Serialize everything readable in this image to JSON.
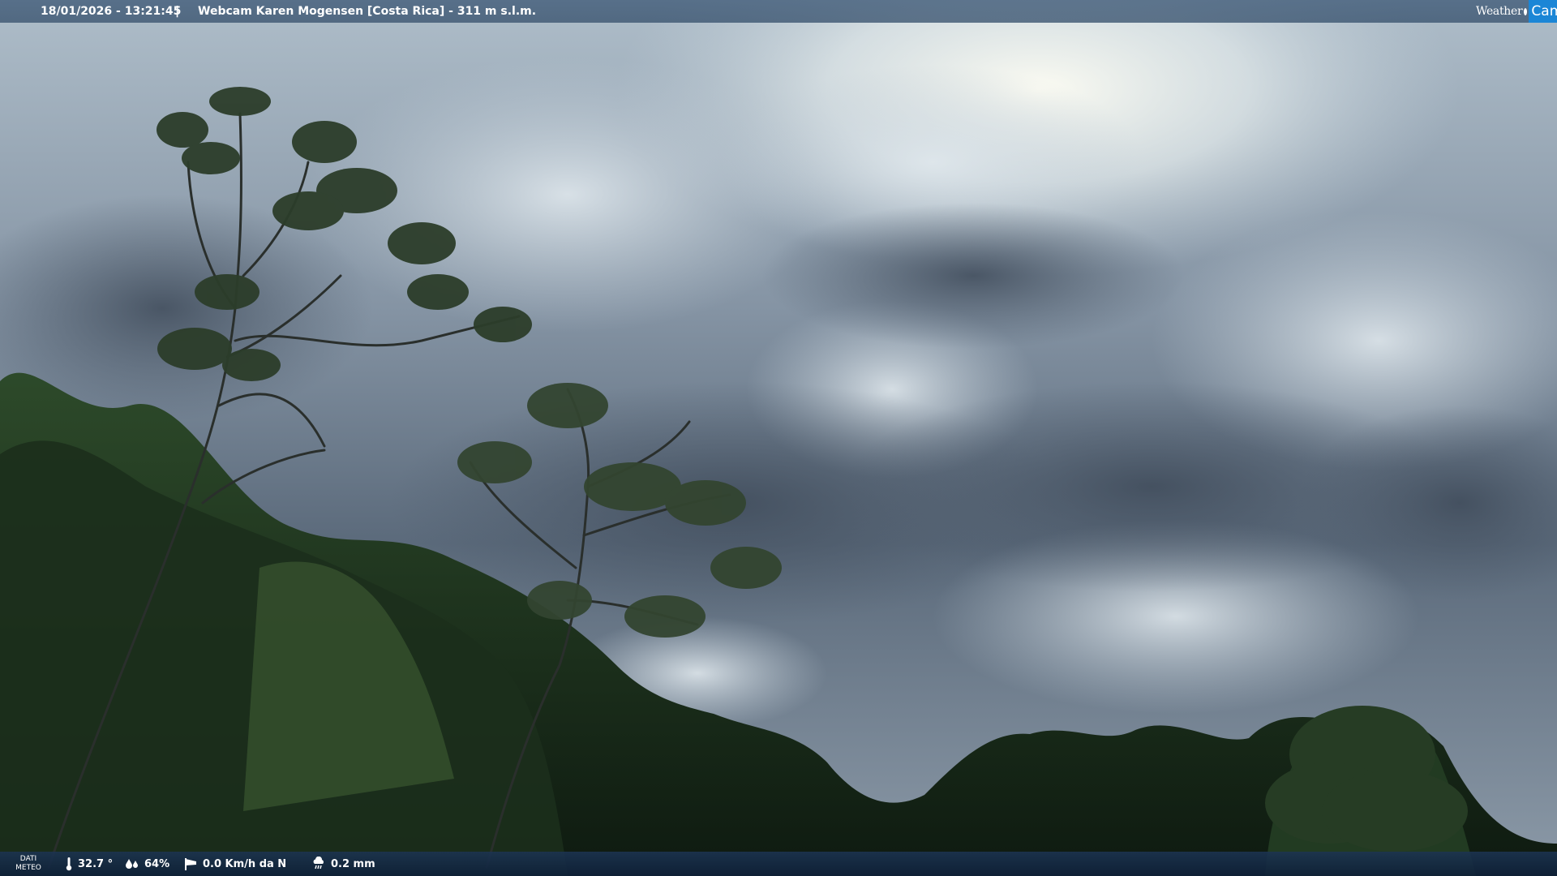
{
  "header": {
    "datetime": "18/01/2026 - 13:21:45",
    "separator": "|",
    "title": "Webcam Karen Mogensen [Costa Rica] - 311 m s.l.m."
  },
  "logo": {
    "word": "Weather",
    "cam": "Cam"
  },
  "meteo": {
    "label_line1": "DATI",
    "label_line2": "METEO",
    "temperature": "32.7 °",
    "humidity": "64%",
    "wind": "0.0 Km/h da N",
    "rain": "0.2 mm"
  },
  "icons": {
    "temperature": "thermometer-icon",
    "humidity": "humidity-drops-icon",
    "wind": "wind-sock-icon",
    "rain": "rain-cloud-icon"
  },
  "colors": {
    "sky_bright": "#e9f0f4",
    "sky_dark": "#4e5c6d",
    "foliage": "#1f3520",
    "bar_top": "#3e5e80",
    "bar_bottom": "#102640",
    "logo_accent": "#1b86d6"
  }
}
